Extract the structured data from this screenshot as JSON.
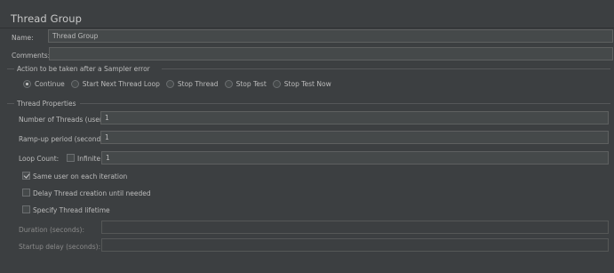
{
  "panel": {
    "title": "Thread Group"
  },
  "name": {
    "label": "Name:",
    "value": "Thread Group"
  },
  "comments": {
    "label": "Comments:",
    "value": ""
  },
  "sampler_error": {
    "title": "Action to be taken after a Sampler error",
    "options": [
      "Continue",
      "Start Next Thread Loop",
      "Stop Thread",
      "Stop Test",
      "Stop Test Now"
    ],
    "selected": "Continue"
  },
  "thread_props": {
    "title": "Thread Properties",
    "num_threads_label": "Number of Threads (users):",
    "num_threads_value": "1",
    "rampup_label": "Ramp-up period (seconds):",
    "rampup_value": "1",
    "loop_label": "Loop Count:",
    "infinite_label": "Infinite",
    "infinite_checked": false,
    "loop_value": "1",
    "same_user_label": "Same user on each iteration",
    "same_user_checked": true,
    "delay_label": "Delay Thread creation until needed",
    "delay_checked": false,
    "lifetime_label": "Specify Thread lifetime",
    "lifetime_checked": false,
    "duration_label": "Duration (seconds):",
    "duration_value": "",
    "startup_label": "Startup delay (seconds):",
    "startup_value": ""
  }
}
